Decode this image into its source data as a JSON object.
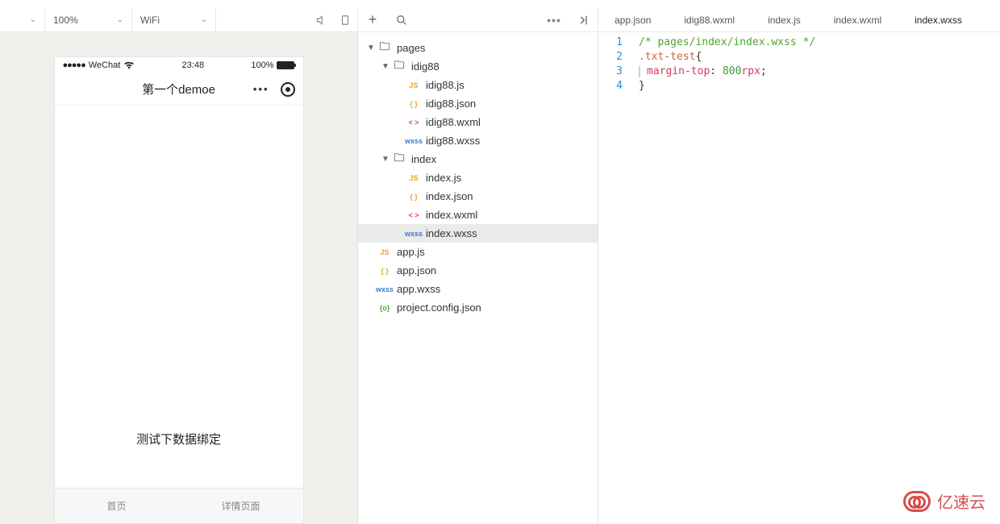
{
  "toolbar": {
    "device_chevron": "⌄",
    "zoom": "100%",
    "network": "WiFi",
    "sound_icon": "sound",
    "rotate_icon": "rotate",
    "plus_icon": "+",
    "search_icon": "search",
    "more_icon": "•••",
    "collapse_icon": "collapse"
  },
  "editor_tabs": [
    {
      "label": "app.json",
      "active": false
    },
    {
      "label": "idig88.wxml",
      "active": false
    },
    {
      "label": "index.js",
      "active": false
    },
    {
      "label": "index.wxml",
      "active": false
    },
    {
      "label": "index.wxss",
      "active": true
    }
  ],
  "simulator": {
    "carrier": "WeChat",
    "signal": "●●●●●",
    "time": "23:48",
    "battery_pct": "100%",
    "nav_title": "第一个demoe",
    "nav_dots": "•••",
    "body_text": "测试下数据绑定",
    "tabbar": [
      "首页",
      "详情页面"
    ]
  },
  "file_tree": [
    {
      "indent": 0,
      "caret": "▼",
      "type": "folder",
      "label": "pages"
    },
    {
      "indent": 1,
      "caret": "▼",
      "type": "folder",
      "label": "idig88"
    },
    {
      "indent": 2,
      "caret": "",
      "type": "js",
      "label": "idig88.js"
    },
    {
      "indent": 2,
      "caret": "",
      "type": "json",
      "label": "idig88.json"
    },
    {
      "indent": 2,
      "caret": "",
      "type": "wxml",
      "label": "idig88.wxml"
    },
    {
      "indent": 2,
      "caret": "",
      "type": "wxss",
      "label": "idig88.wxss"
    },
    {
      "indent": 1,
      "caret": "▼",
      "type": "folder",
      "label": "index"
    },
    {
      "indent": 2,
      "caret": "",
      "type": "js",
      "label": "index.js"
    },
    {
      "indent": 2,
      "caret": "",
      "type": "json",
      "label": "index.json"
    },
    {
      "indent": 2,
      "caret": "",
      "type": "wxml",
      "label": "index.wxml"
    },
    {
      "indent": 2,
      "caret": "",
      "type": "wxss",
      "label": "index.wxss",
      "selected": true
    },
    {
      "indent": 0,
      "caret": "",
      "type": "js",
      "label": "app.js"
    },
    {
      "indent": 0,
      "caret": "",
      "type": "json",
      "label": "app.json"
    },
    {
      "indent": 0,
      "caret": "",
      "type": "wxss",
      "label": "app.wxss"
    },
    {
      "indent": 0,
      "caret": "",
      "type": "config",
      "label": "project.config.json"
    }
  ],
  "file_icons": {
    "folder": "🗀",
    "js": "JS",
    "json": "{ }",
    "wxml": "< >",
    "wxss": "wxss",
    "config": "{o}"
  },
  "code": {
    "line_numbers": [
      "1",
      "2",
      "3",
      "4"
    ],
    "l1_comment": "/* pages/index/index.wxss */",
    "l2_selector": ".txt-test",
    "l2_brace": "{",
    "l3_prop": "margin-top",
    "l3_colon": ": ",
    "l3_val": "800",
    "l3_unit": "rpx",
    "l3_semi": ";",
    "l4_brace": "}"
  },
  "watermark": "亿速云"
}
